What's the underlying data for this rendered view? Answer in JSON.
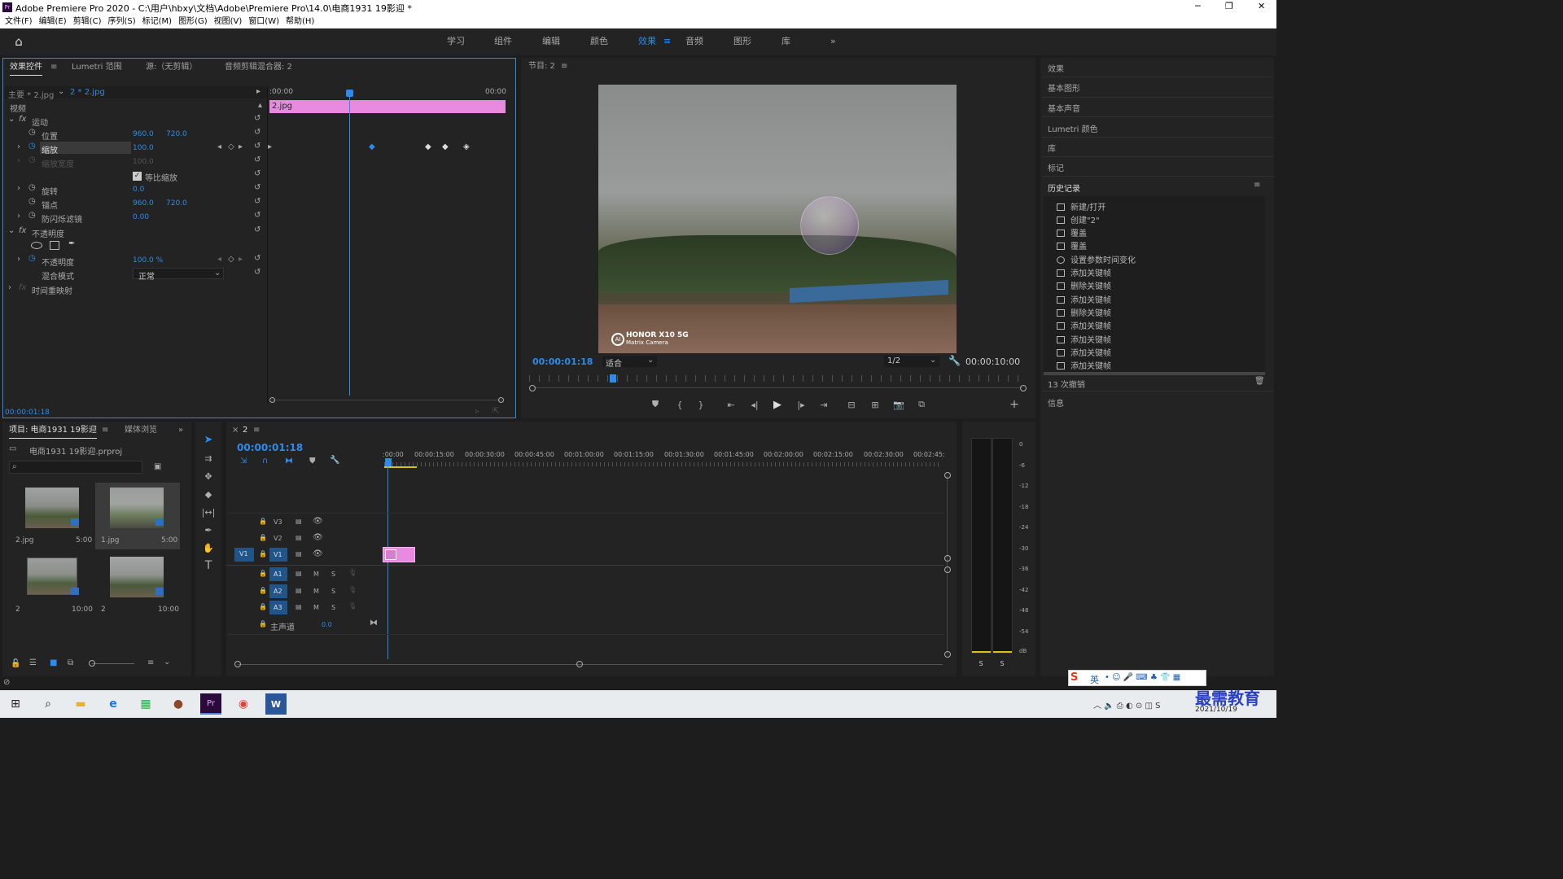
{
  "titlebar": {
    "title": "Adobe Premiere Pro 2020 - C:\\用户\\hbxy\\文档\\Adobe\\Premiere Pro\\14.0\\电商1931  19影迎 *",
    "minimize": "─",
    "maximize": "❐",
    "close": "✕"
  },
  "menu": [
    "文件(F)",
    "编辑(E)",
    "剪辑(C)",
    "序列(S)",
    "标记(M)",
    "图形(G)",
    "视图(V)",
    "窗口(W)",
    "帮助(H)"
  ],
  "workspaces": [
    "学习",
    "组件",
    "编辑",
    "颜色",
    "效果",
    "音频",
    "图形",
    "库"
  ],
  "workspace_active": "效果",
  "effect_controls": {
    "tabs": [
      "效果控件",
      "Lumetri 范围",
      "源:（无剪辑）",
      "音频剪辑混合器: 2"
    ],
    "master": "主要 * 2.jpg",
    "clip": "2 * 2.jpg",
    "time_start": ":00:00",
    "time_end": "00:00",
    "clip_bar": "2.jpg",
    "section_video": "视频",
    "motion": "运动",
    "opacity_group": "不透明度",
    "time_remap": "时间重映射",
    "props": [
      {
        "name": "位置",
        "v1": "960.0",
        "v2": "720.0"
      },
      {
        "name": "缩放",
        "v1": "100.0",
        "v2": ""
      },
      {
        "name": "缩放宽度",
        "v1": "100.0",
        "v2": ""
      },
      {
        "name": "等比缩放",
        "v1": "",
        "v2": ""
      },
      {
        "name": "旋转",
        "v1": "0.0",
        "v2": ""
      },
      {
        "name": "锚点",
        "v1": "960.0",
        "v2": "720.0"
      },
      {
        "name": "防闪烁滤镜",
        "v1": "0.00",
        "v2": ""
      }
    ],
    "opacity_name": "不透明度",
    "opacity_value": "100.0 %",
    "blend_label": "混合模式",
    "blend_value": "正常",
    "timecode": "00:00:01:18"
  },
  "program": {
    "title": "节目: 2",
    "timecode": "00:00:01:18",
    "fit": "适合",
    "resolution": "1/2",
    "duration": "00:00:10:00",
    "watermark_brand": "HONOR X10 5G",
    "watermark_sub": "Matrix Camera"
  },
  "right_panel": {
    "items": [
      "效果",
      "基本图形",
      "基本声音",
      "Lumetri 颜色",
      "库",
      "标记"
    ],
    "history_title": "历史记录",
    "history": [
      "新建/打开",
      "创建\"2\"",
      "覆盖",
      "覆盖",
      "设置参数时间变化",
      "添加关键帧",
      "删除关键帧",
      "添加关键帧",
      "删除关键帧",
      "添加关键帧",
      "添加关键帧",
      "添加关键帧",
      "添加关键帧"
    ],
    "undo_count": "13 次撤销",
    "info": "信息"
  },
  "project": {
    "tabs": [
      "项目: 电商1931  19影迎",
      "媒体浏览"
    ],
    "file": "电商1931  19影迎.prproj",
    "thumbs": [
      {
        "name": "2.jpg",
        "dur": "5:00"
      },
      {
        "name": "1.jpg",
        "dur": "5:00"
      },
      {
        "name": "2",
        "dur": "10:00"
      },
      {
        "name": "2",
        "dur": "10:00"
      }
    ]
  },
  "timeline": {
    "tab": "2",
    "timecode": "00:00:01:18",
    "ruler": [
      ":00:00",
      "00:00:15:00",
      "00:00:30:00",
      "00:00:45:00",
      "00:01:00:00",
      "00:01:15:00",
      "00:01:30:00",
      "00:01:45:00",
      "00:02:00:00",
      "00:02:15:00",
      "00:02:30:00",
      "00:02:45:"
    ],
    "video_tracks": [
      "V3",
      "V2",
      "V1"
    ],
    "source_patch": "V1",
    "audio_tracks": [
      "A1",
      "A2",
      "A3"
    ],
    "master": "主声道",
    "master_val": "0.0"
  },
  "meter": {
    "scale": [
      "0",
      "-6",
      "-12",
      "-18",
      "-24",
      "-30",
      "-36",
      "-42",
      "-48",
      "-54",
      "dB"
    ],
    "solo": [
      "S",
      "S"
    ]
  },
  "taskbar": {
    "ime": "英",
    "date": "2021/10/19",
    "watermark": "最需教育"
  },
  "colors": {
    "accent": "#2d8ceb",
    "clip_pink": "#e88be0",
    "panel": "#232323"
  }
}
